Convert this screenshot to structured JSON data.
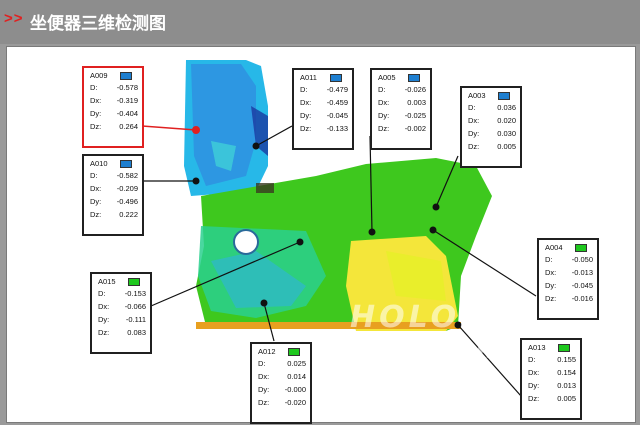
{
  "header": {
    "chevrons": ">>",
    "title": "坐便器三维检测图"
  },
  "watermark": "HOLON 3D.COM",
  "colors": {
    "accent_red": "#e02020",
    "header_bg": "#8d8d8d",
    "swatch_blue": "#1e7fd0",
    "swatch_green": "#1ec81e"
  },
  "annotations": [
    {
      "id": "A009",
      "swatch": "blue",
      "D": "-0.578",
      "Dx": "-0.319",
      "Dy": "-0.404",
      "Dz": "0.264"
    },
    {
      "id": "A010",
      "swatch": "blue",
      "D": "-0.582",
      "Dx": "-0.209",
      "Dy": "-0.496",
      "Dz": "0.222"
    },
    {
      "id": "A011",
      "swatch": "blue",
      "D": "-0.479",
      "Dx": "-0.459",
      "Dy": "-0.045",
      "Dz": "-0.133"
    },
    {
      "id": "A005",
      "swatch": "blue",
      "D": "-0.026",
      "Dx": "0.003",
      "Dy": "-0.025",
      "Dz": "-0.002"
    },
    {
      "id": "A003",
      "swatch": "green",
      "D": "0.036",
      "Dx": "0.020",
      "Dy": "0.030",
      "Dz": "0.005"
    },
    {
      "id": "A015",
      "swatch": "green",
      "D": "-0.153",
      "Dx": "-0.066",
      "Dy": "-0.111",
      "Dz": "0.083"
    },
    {
      "id": "A004",
      "swatch": "green",
      "D": "-0.050",
      "Dx": "-0.013",
      "Dy": "-0.045",
      "Dz": "-0.016"
    },
    {
      "id": "A012",
      "swatch": "green",
      "D": "0.025",
      "Dx": "0.014",
      "Dy": "-0.000",
      "Dz": "-0.020"
    },
    {
      "id": "A013",
      "swatch": "green",
      "D": "0.155",
      "Dx": "0.154",
      "Dy": "0.013",
      "Dz": "0.005"
    }
  ]
}
